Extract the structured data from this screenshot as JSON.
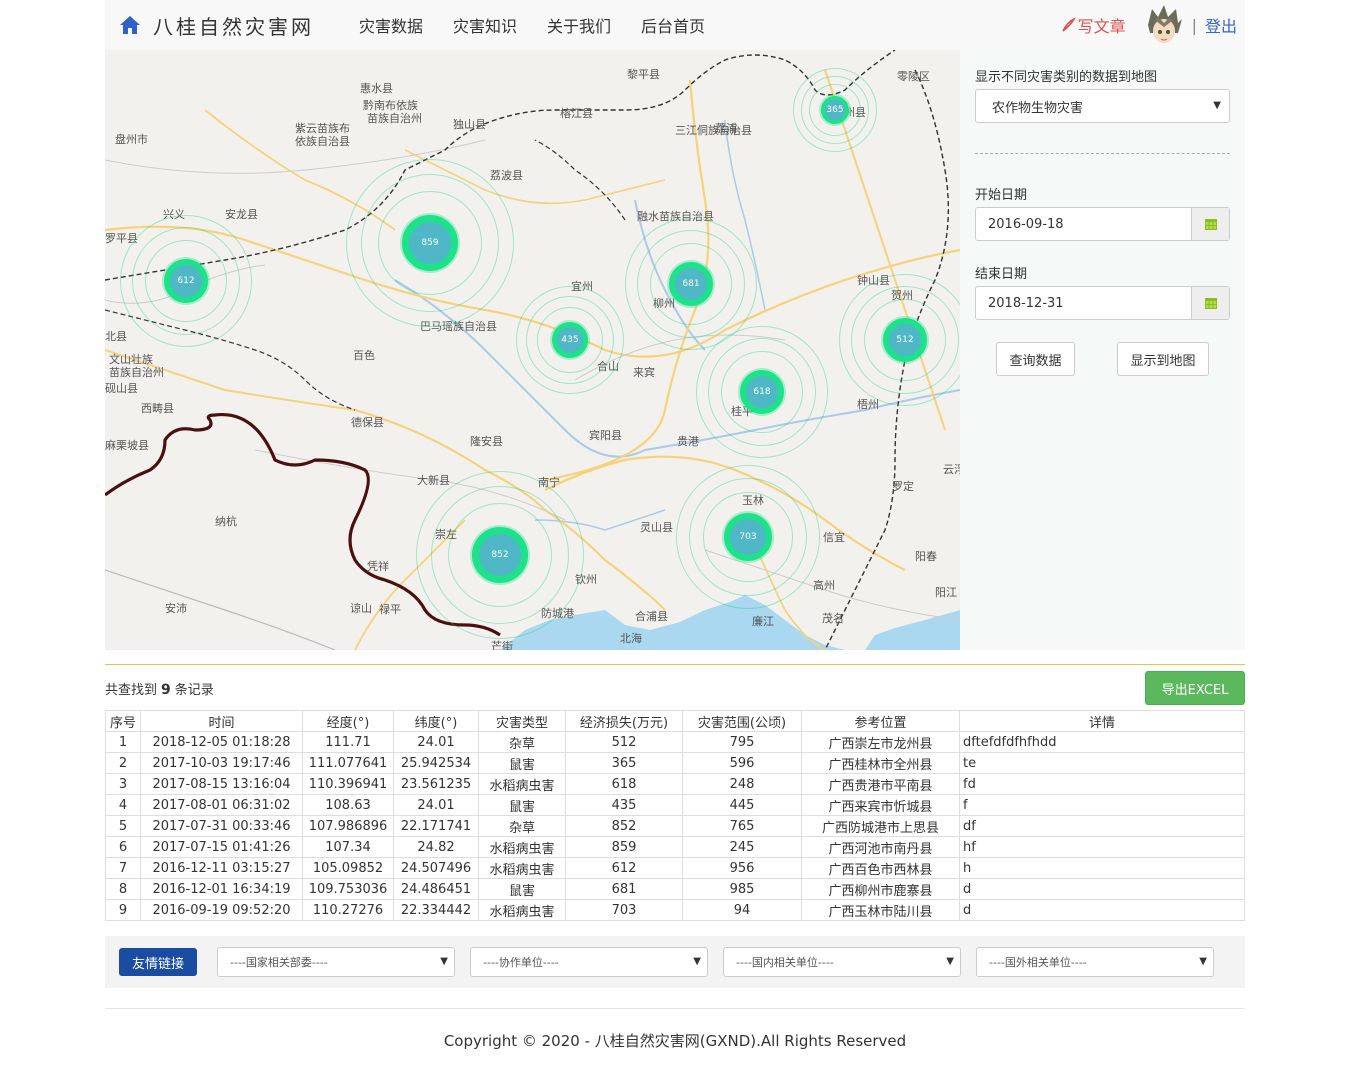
{
  "nav": {
    "brand": "八桂自然灾害网",
    "items": [
      "灾害数据",
      "灾害知识",
      "关于我们",
      "后台首页"
    ],
    "write": "写文章",
    "separator": "|",
    "logout": "登出"
  },
  "map": {
    "labels": [
      "惠水县",
      "黔南布依族",
      "苗族自治州",
      "榕江县",
      "三江侗族自治县",
      "独山县",
      "荔波县",
      "紫云苗族布",
      "依族自治县",
      "盘州市",
      "兴义",
      "安龙县",
      "罗平县",
      "融水苗族自治县",
      "宜州",
      "柳州",
      "钟山县",
      "贺州",
      "巴马瑶族自治县",
      "百色",
      "合山",
      "来宾",
      "文山壮族",
      "苗族自治州",
      "砚山县",
      "西畴县",
      "德保县",
      "宾阳县",
      "贵港",
      "桂平",
      "梧州",
      "麻栗坡县",
      "隆安县",
      "南宁",
      "大新县",
      "玉林",
      "罗定",
      "云浮",
      "纳杭",
      "崇左",
      "灵山县",
      "信宜",
      "阳春",
      "凭祥",
      "钦州",
      "高州",
      "安沛",
      "谅山",
      "禄平",
      "防城港",
      "合浦县",
      "廉江",
      "茂名",
      "阳江",
      "北海",
      "芒街",
      "黎平县",
      "零陵区",
      "荔浦",
      "北县",
      "全州县"
    ],
    "clusters": [
      {
        "label": "365"
      },
      {
        "label": "859"
      },
      {
        "label": "612"
      },
      {
        "label": "681"
      },
      {
        "label": "435"
      },
      {
        "label": "512"
      },
      {
        "label": "618"
      },
      {
        "label": "703"
      },
      {
        "label": "852"
      }
    ]
  },
  "side": {
    "category_label": "显示不同灾害类别的数据到地图",
    "category_value": "农作物生物灾害",
    "start_label": "开始日期",
    "start_value": "2016-09-18",
    "end_label": "结束日期",
    "end_value": "2018-12-31",
    "query_btn": "查询数据",
    "show_btn": "显示到地图"
  },
  "results": {
    "prefix": "共查找到",
    "count": "9",
    "suffix": "条记录",
    "export": "导出EXCEL"
  },
  "table": {
    "headers": [
      "序号",
      "时间",
      "经度(°)",
      "纬度(°)",
      "灾害类型",
      "经济损失(万元)",
      "灾害范围(公顷)",
      "参考位置",
      "详情"
    ],
    "rows": [
      [
        "1",
        "2018-12-05 01:18:28",
        "111.71",
        "24.01",
        "杂草",
        "512",
        "795",
        "广西崇左市龙州县",
        "dftefdfdfhfhdd"
      ],
      [
        "2",
        "2017-10-03 19:17:46",
        "111.077641",
        "25.942534",
        "鼠害",
        "365",
        "596",
        "广西桂林市全州县",
        "te"
      ],
      [
        "3",
        "2017-08-15 13:16:04",
        "110.396941",
        "23.561235",
        "水稻病虫害",
        "618",
        "248",
        "广西贵港市平南县",
        "fd"
      ],
      [
        "4",
        "2017-08-01 06:31:02",
        "108.63",
        "24.01",
        "鼠害",
        "435",
        "445",
        "广西来宾市忻城县",
        "f"
      ],
      [
        "5",
        "2017-07-31 00:33:46",
        "107.986896",
        "22.171741",
        "杂草",
        "852",
        "765",
        "广西防城港市上思县",
        "df"
      ],
      [
        "6",
        "2017-07-15 01:41:26",
        "107.34",
        "24.82",
        "水稻病虫害",
        "859",
        "245",
        "广西河池市南丹县",
        "hf"
      ],
      [
        "7",
        "2016-12-11 03:15:27",
        "105.09852",
        "24.507496",
        "水稻病虫害",
        "612",
        "956",
        "广西百色市西林县",
        "h"
      ],
      [
        "8",
        "2016-12-01 16:34:19",
        "109.753036",
        "24.486451",
        "鼠害",
        "681",
        "985",
        "广西柳州市鹿寨县",
        "d"
      ],
      [
        "9",
        "2016-09-19 09:52:20",
        "110.27276",
        "22.334442",
        "水稻病虫害",
        "703",
        "94",
        "广西玉林市陆川县",
        "d"
      ]
    ]
  },
  "links": {
    "badge": "友情链接",
    "selects": [
      "----国家相关部委----",
      "----协作单位----",
      "----国内相关单位----",
      "----国外相关单位----"
    ]
  },
  "footer": {
    "copyright": "Copyright © 2020 - 八桂自然灾害网(GXND).All Rights Reserved"
  },
  "colors": {
    "brand_blue": "#1a4da1",
    "cluster_green": "#1de28a",
    "cluster_core": "#4fb7c5",
    "export_green": "#5cb85c",
    "write_red": "#d9534f"
  }
}
